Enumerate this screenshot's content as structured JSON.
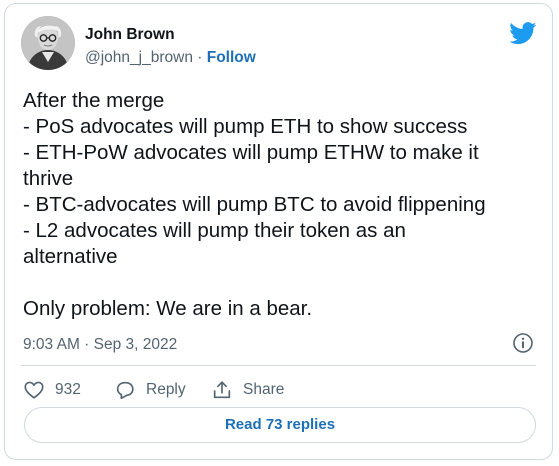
{
  "author": {
    "name": "John Brown",
    "handle": "@john_j_brown",
    "separator": "·",
    "follow_label": "Follow",
    "avatar_icon": "person-portrait-icon"
  },
  "logo": {
    "icon": "twitter-bird-icon",
    "color": "#1d9bf0"
  },
  "tweet": {
    "lines": [
      "After the merge",
      "- PoS advocates will pump ETH to show success",
      "- ETH-PoW advocates will pump ETHW to make it",
      "thrive",
      "- BTC-advocates will pump BTC to avoid flippening",
      "- L2 advocates will pump their token as an",
      "alternative",
      "",
      "Only problem: We are in a bear."
    ]
  },
  "meta": {
    "timestamp": "9:03 AM · Sep 3, 2022",
    "info_icon": "info-icon"
  },
  "actions": {
    "like_count": "932",
    "reply_label": "Reply",
    "share_label": "Share"
  },
  "footer": {
    "read_replies_label": "Read 73 replies"
  },
  "colors": {
    "link": "#1d70b8",
    "text": "#0f1419",
    "secondary": "#536471",
    "border": "#cfd9de"
  }
}
